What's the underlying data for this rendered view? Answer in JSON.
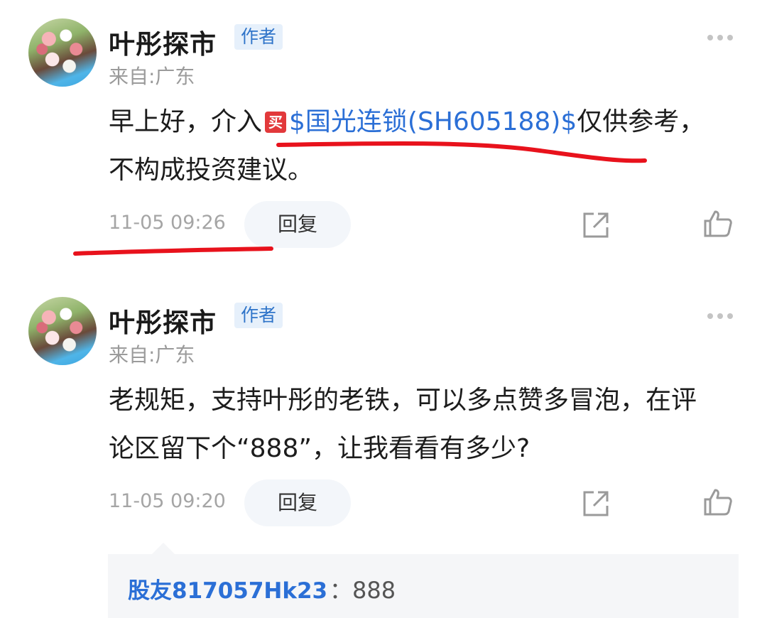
{
  "comments": [
    {
      "username": "叶彤探市",
      "badge": "作者",
      "location": "来自:广东",
      "text_before": "早上好，介入",
      "buy_mark": "买",
      "stock": "$国光连锁(SH605188)$",
      "text_after": "仅供参考，不构成投资建议。",
      "time": "11-05 09:26",
      "reply_label": "回复"
    },
    {
      "username": "叶彤探市",
      "badge": "作者",
      "location": "来自:广东",
      "text": "老规矩，支持叶彤的老铁，可以多点赞多冒泡，在评论区留下个“888”，让我看看有多少?",
      "time": "11-05 09:20",
      "reply_label": "回复"
    }
  ],
  "sub_reply": {
    "user": "股友817057Hk23",
    "separator": "：",
    "text": "888"
  },
  "icons": {
    "more": "more-dots-icon",
    "share": "share-icon",
    "like": "thumbs-up-icon"
  },
  "colors": {
    "link": "#2b6fd6",
    "badge_bg": "#e6f0fb",
    "annotation_red": "#e8121c"
  }
}
